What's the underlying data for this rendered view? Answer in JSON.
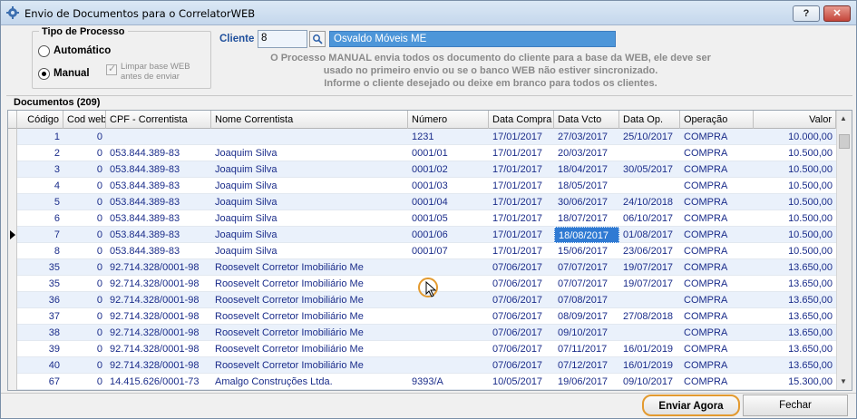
{
  "window": {
    "title": "Envio de Documentos para o CorrelatorWEB",
    "help_label": "?",
    "close_label": "✕"
  },
  "process": {
    "group_title": "Tipo de Processo",
    "option_auto": "Automático",
    "option_manual": "Manual",
    "selected": "Manual",
    "checkbox_label": "Limpar base WEB antes de enviar"
  },
  "cliente": {
    "label": "Cliente",
    "code": "8",
    "name": "Osvaldo Móveis ME"
  },
  "info": {
    "line1": "O Processo MANUAL envia todos os documento do cliente para a base da WEB, ele deve ser",
    "line2": "usado no primeiro envio ou se o banco WEB não estiver sincronizado.",
    "line3": "Informe o cliente desejado ou deixe em branco para todos os clientes."
  },
  "documents": {
    "title": "Documentos (209)",
    "columns": [
      "Código",
      "Cod web",
      "CPF - Correntista",
      "Nome Correntista",
      "Número",
      "Data Compra",
      "Data Vcto",
      "Data Op.",
      "Operação",
      "Valor"
    ],
    "rows": [
      [
        "1",
        "0",
        "",
        "",
        "1231",
        "17/01/2017",
        "27/03/2017",
        "25/10/2017",
        "COMPRA",
        "10.000,00"
      ],
      [
        "2",
        "0",
        "053.844.389-83",
        "Joaquim Silva",
        "0001/01",
        "17/01/2017",
        "20/03/2017",
        "",
        "COMPRA",
        "10.500,00"
      ],
      [
        "3",
        "0",
        "053.844.389-83",
        "Joaquim Silva",
        "0001/02",
        "17/01/2017",
        "18/04/2017",
        "30/05/2017",
        "COMPRA",
        "10.500,00"
      ],
      [
        "4",
        "0",
        "053.844.389-83",
        "Joaquim Silva",
        "0001/03",
        "17/01/2017",
        "18/05/2017",
        "",
        "COMPRA",
        "10.500,00"
      ],
      [
        "5",
        "0",
        "053.844.389-83",
        "Joaquim Silva",
        "0001/04",
        "17/01/2017",
        "30/06/2017",
        "24/10/2018",
        "COMPRA",
        "10.500,00"
      ],
      [
        "6",
        "0",
        "053.844.389-83",
        "Joaquim Silva",
        "0001/05",
        "17/01/2017",
        "18/07/2017",
        "06/10/2017",
        "COMPRA",
        "10.500,00"
      ],
      [
        "7",
        "0",
        "053.844.389-83",
        "Joaquim Silva",
        "0001/06",
        "17/01/2017",
        "18/08/2017",
        "01/08/2017",
        "COMPRA",
        "10.500,00"
      ],
      [
        "8",
        "0",
        "053.844.389-83",
        "Joaquim Silva",
        "0001/07",
        "17/01/2017",
        "15/06/2017",
        "23/06/2017",
        "COMPRA",
        "10.500,00"
      ],
      [
        "35",
        "0",
        "92.714.328/0001-98",
        "Roosevelt Corretor Imobiliário Me",
        "",
        "07/06/2017",
        "07/07/2017",
        "19/07/2017",
        "COMPRA",
        "13.650,00"
      ],
      [
        "35",
        "0",
        "92.714.328/0001-98",
        "Roosevelt Corretor Imobiliário Me",
        "",
        "07/06/2017",
        "07/07/2017",
        "19/07/2017",
        "COMPRA",
        "13.650,00"
      ],
      [
        "36",
        "0",
        "92.714.328/0001-98",
        "Roosevelt Corretor Imobiliário Me",
        "",
        "07/06/2017",
        "07/08/2017",
        "",
        "COMPRA",
        "13.650,00"
      ],
      [
        "37",
        "0",
        "92.714.328/0001-98",
        "Roosevelt Corretor Imobiliário Me",
        "",
        "07/06/2017",
        "08/09/2017",
        "27/08/2018",
        "COMPRA",
        "13.650,00"
      ],
      [
        "38",
        "0",
        "92.714.328/0001-98",
        "Roosevelt Corretor Imobiliário Me",
        "",
        "07/06/2017",
        "09/10/2017",
        "",
        "COMPRA",
        "13.650,00"
      ],
      [
        "39",
        "0",
        "92.714.328/0001-98",
        "Roosevelt Corretor Imobiliário Me",
        "",
        "07/06/2017",
        "07/11/2017",
        "16/01/2019",
        "COMPRA",
        "13.650,00"
      ],
      [
        "40",
        "0",
        "92.714.328/0001-98",
        "Roosevelt Corretor Imobiliário Me",
        "",
        "07/06/2017",
        "07/12/2017",
        "16/01/2019",
        "COMPRA",
        "13.650,00"
      ],
      [
        "67",
        "0",
        "14.415.626/0001-73",
        "Amalgo Construções Ltda.",
        "9393/A",
        "10/05/2017",
        "19/06/2017",
        "09/10/2017",
        "COMPRA",
        "15.300,00"
      ]
    ],
    "current_row": 6,
    "selected_cell_col": 6
  },
  "buttons": {
    "send": "Enviar Agora",
    "close": "Fechar"
  },
  "colors": {
    "accent": "#4d96d9",
    "highlight_ring": "#e39a2f",
    "row_text": "#1a2c8a"
  }
}
